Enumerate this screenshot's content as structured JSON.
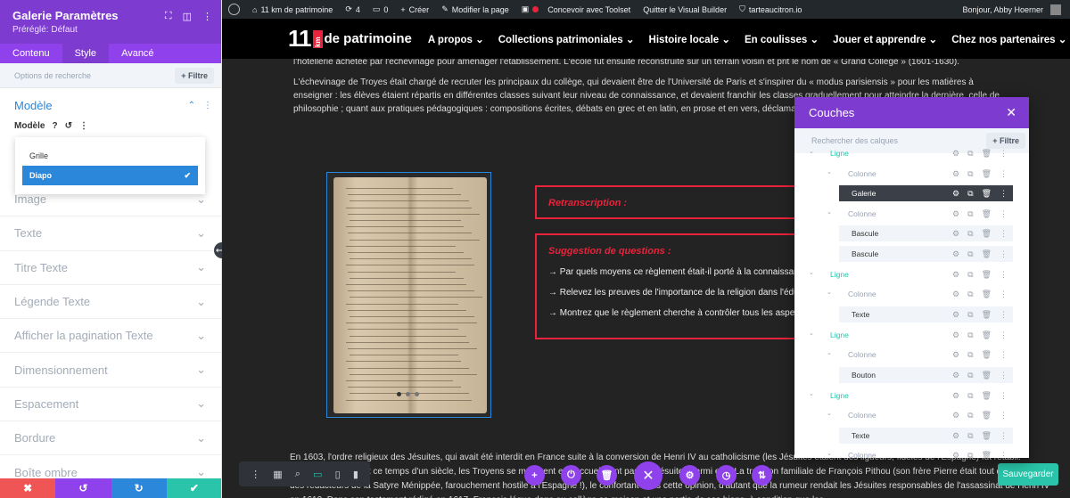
{
  "left_panel": {
    "title": "Galerie Paramètres",
    "preset": "Préréglé: Défaut",
    "tabs": [
      "Contenu",
      "Style",
      "Avancé"
    ],
    "active_tab": "Style",
    "search_placeholder": "Options de recherche",
    "filter_label": "+ Filtre",
    "section_title": "Modèle",
    "field_label": "Modèle",
    "dropdown_options": [
      "Grille",
      "Diapo"
    ],
    "selected_option": "Diapo",
    "sections": [
      "Image",
      "Texte",
      "Titre Texte",
      "Légende Texte",
      "Afficher la pagination Texte",
      "Dimensionnement",
      "Espacement",
      "Bordure",
      "Boîte ombre"
    ],
    "footer_colors": [
      "#ef5555",
      "#8f42ec",
      "#2b87da",
      "#29c4a9"
    ]
  },
  "adminbar": {
    "site": "11 km de patrimoine",
    "updates": "4",
    "comments": "0",
    "create": "Créer",
    "edit_page": "Modifier la page",
    "toolset": "Concevoir avec Toolset",
    "exit_builder": "Quitter le Visual Builder",
    "domain": "tarteaucitron.io",
    "greeting": "Bonjour, Abby Hoerner"
  },
  "site_header": {
    "logo_number": "11",
    "logo_km": "km",
    "logo_text": "de patrimoine",
    "menu": [
      "A propos",
      "Collections patrimoniales",
      "Histoire locale",
      "En coulisses",
      "Jouer et apprendre",
      "Chez nos partenaires"
    ]
  },
  "content": {
    "intro_cut": "l'hôtellerie achetée par l'échevinage pour aménager l'établissement. L'école fut ensuite reconstruite sur un terrain voisin et prit le nom de « Grand Collège » (1601-1630).",
    "intro_para": "L'échevinage de Troyes était chargé de recruter les principaux du collège, qui devaient être de l'Université de Paris et s'inspirer du « modus parisiensis » pour les matières à enseigner : les élèves étaient répartis en différentes classes suivant leur niveau de connaissance, et devaient franchir les classes graduellement pour atteindre la dernière, celle de philosophie ; quant aux pratiques pédagogiques : compositions écrites, débats en grec et en latin, en prose et en vers, déclamations, représentations de tragédies et de comiques…",
    "box1_title": "Retranscription :",
    "box2_title": "Suggestion de questions :",
    "questions": [
      "→ Par quels moyens ce règlement était-il porté à la connaissance",
      "→ Relevez les preuves de l'importance de la religion dans l'édu",
      "→ Montrez que le règlement cherche à contrôler tous les aspe"
    ],
    "bottom_para": "En 1603, l'ordre religieux des Jésuites, qui avait été interdit en France suite à la conversion de Henri IV au catholicisme (les Jésuites étaient des ligueurs, fidèles de l'Espagne) fut rétabli. Cependant, pendant ce temps d'un siècle, les Troyens se méfièrent et n'accueillirent pas les Jésuites parmi eux. La tradition familiale de François Pithou (son frère Pierre était tout de même l'un des rédacteurs de la Satyre Ménippée, farouchement hostile à l'Espagne !), le confortant dans cette opinion, d'autant que la rumeur rendait les Jésuites responsables de l'assassinat de Henri IV en 1610. Dans son testament rédigé en 1617, François légua donc au collège sa maison et une partie de ses biens, à condition que les"
  },
  "toolbar": {
    "save_label": "Sauvegarder"
  },
  "layers": {
    "title": "Couches",
    "search_placeholder": "Rechercher des calques",
    "filter_label": "+ Filtre",
    "items": [
      {
        "label": "Ligne",
        "type": "row"
      },
      {
        "label": "Colonne",
        "type": "col"
      },
      {
        "label": "Galerie",
        "type": "sel"
      },
      {
        "label": "Colonne",
        "type": "col"
      },
      {
        "label": "Bascule",
        "type": "mod"
      },
      {
        "label": "Bascule",
        "type": "mod"
      },
      {
        "label": "Ligne",
        "type": "row"
      },
      {
        "label": "Colonne",
        "type": "col"
      },
      {
        "label": "Texte",
        "type": "mod"
      },
      {
        "label": "Ligne",
        "type": "row"
      },
      {
        "label": "Colonne",
        "type": "col"
      },
      {
        "label": "Bouton",
        "type": "mod"
      },
      {
        "label": "Ligne",
        "type": "row"
      },
      {
        "label": "Colonne",
        "type": "col"
      },
      {
        "label": "Texte",
        "type": "mod"
      },
      {
        "label": "Colonne",
        "type": "col"
      }
    ]
  }
}
